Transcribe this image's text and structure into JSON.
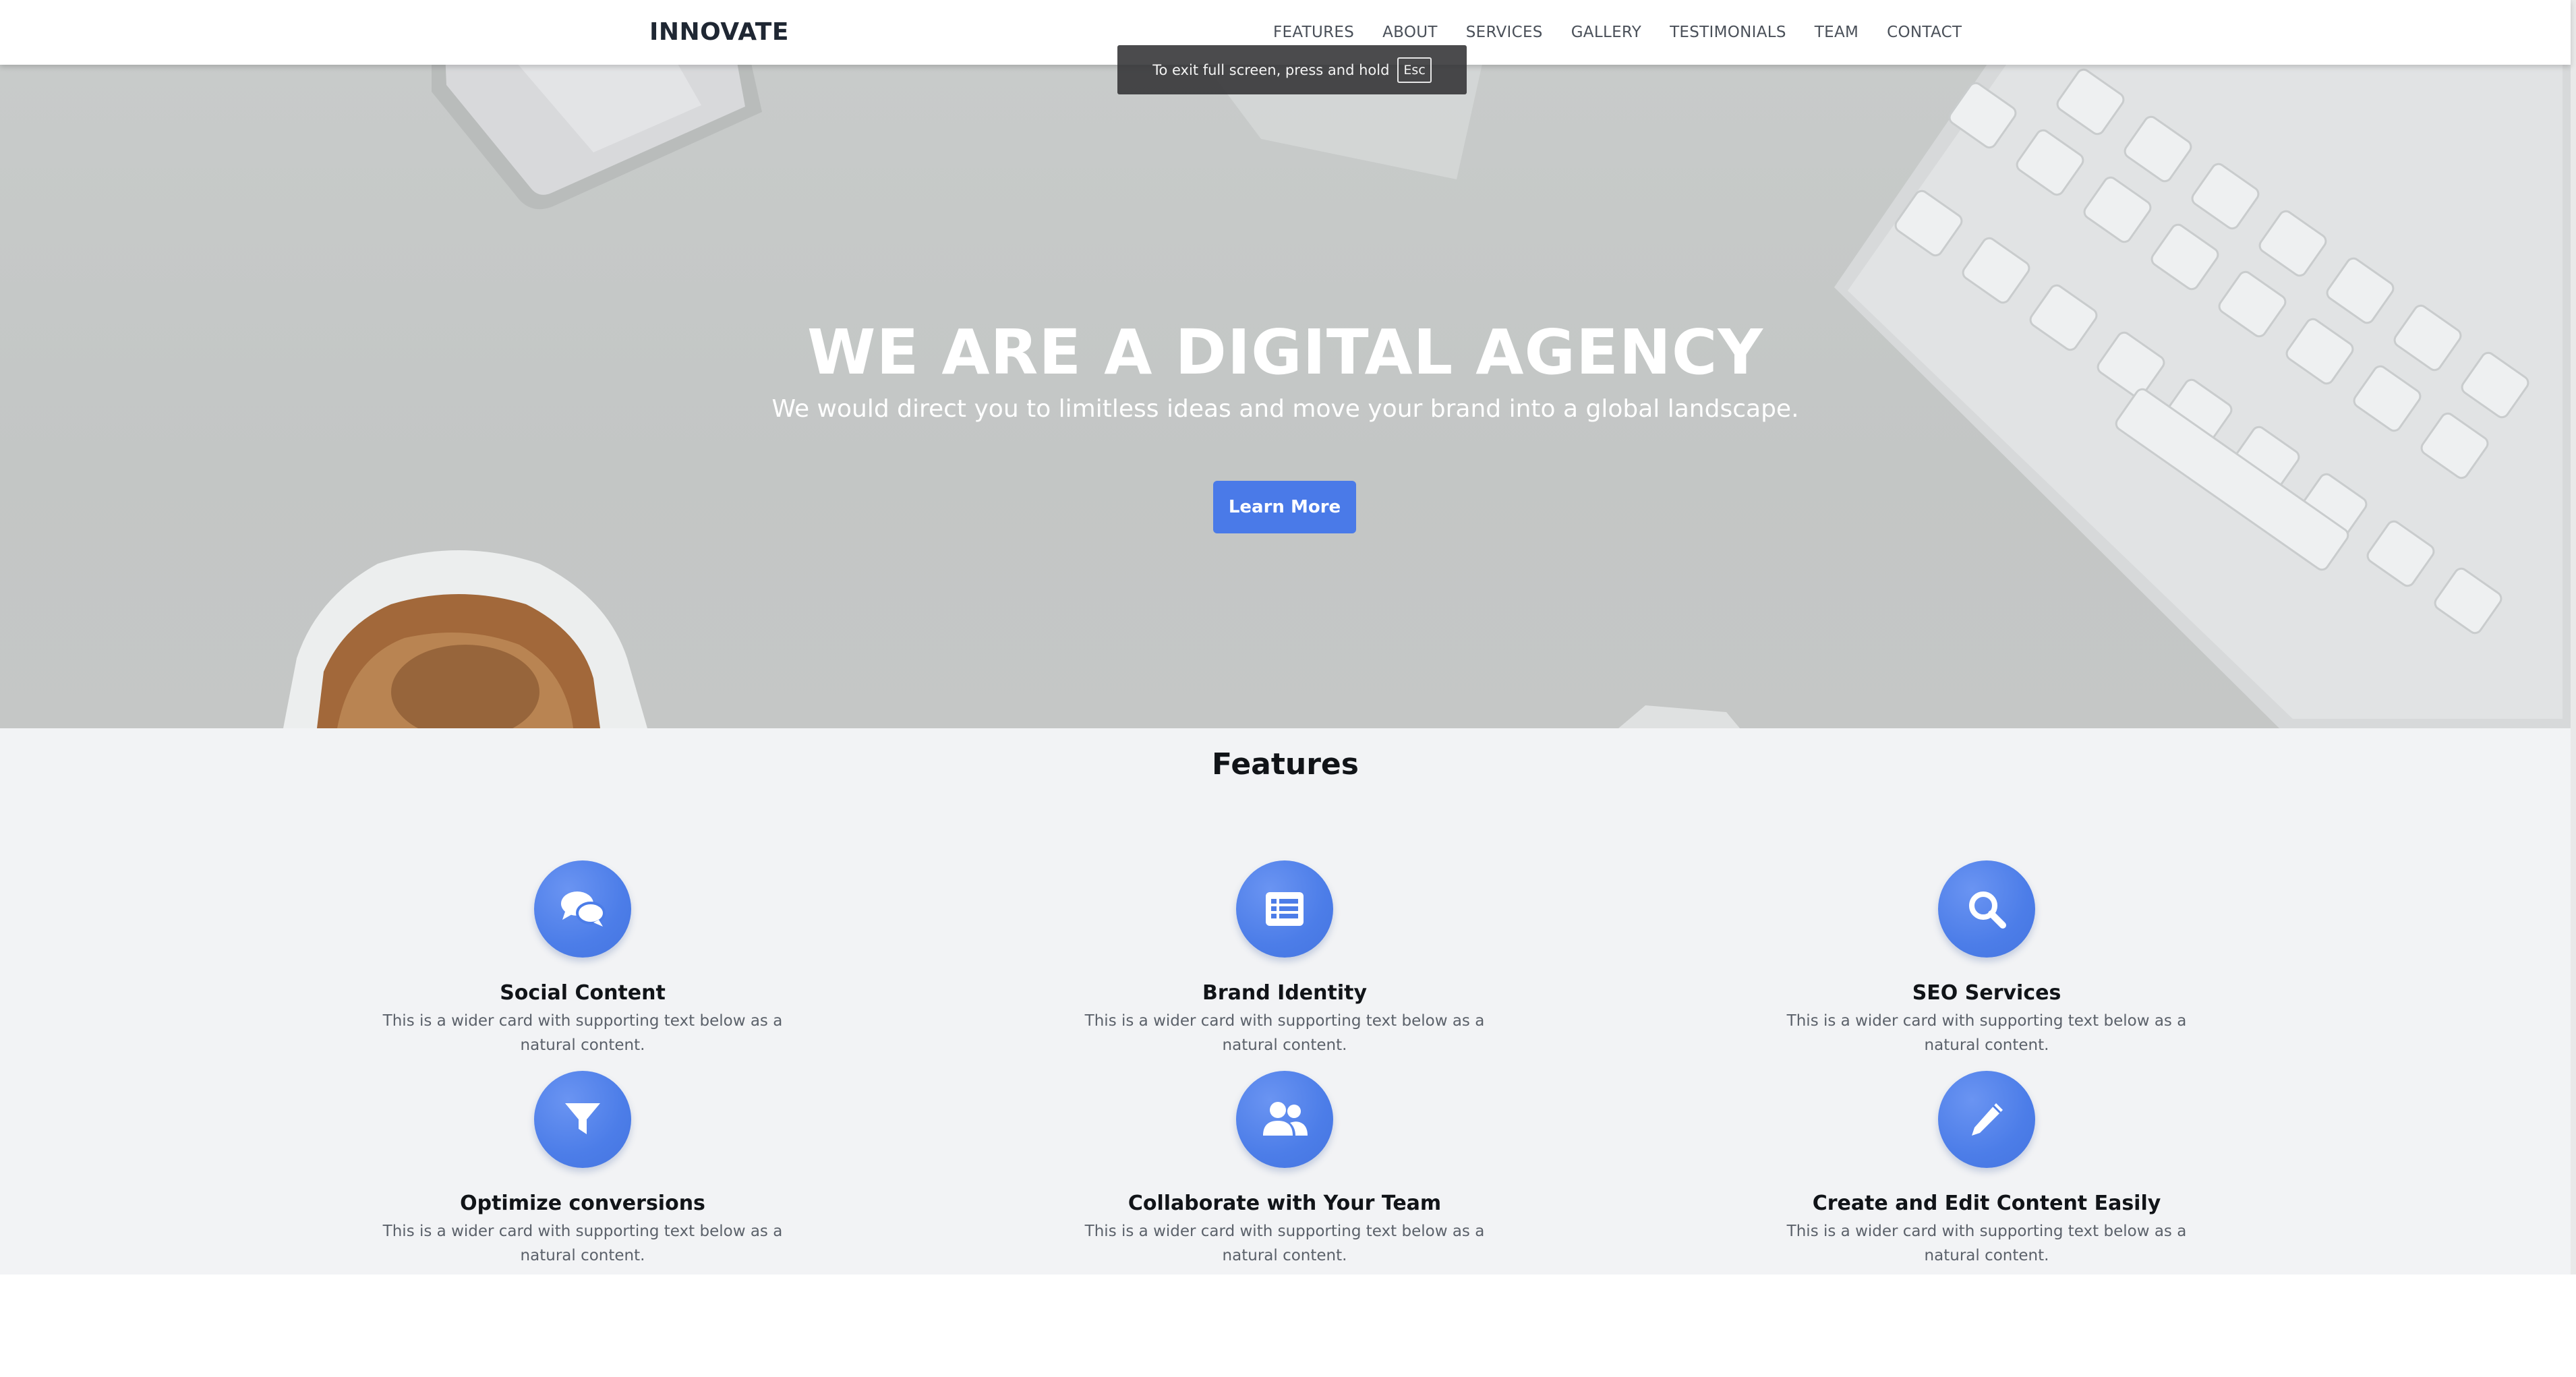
{
  "navbar": {
    "brand": "INNOVATE",
    "links": [
      "FEATURES",
      "ABOUT",
      "SERVICES",
      "GALLERY",
      "TESTIMONIALS",
      "TEAM",
      "CONTACT"
    ]
  },
  "fullscreen_toast": {
    "text": "To exit full screen, press and hold",
    "key": "Esc"
  },
  "hero": {
    "title": "WE ARE A DIGITAL AGENCY",
    "subtitle": "We would direct you to limitless ideas and move your brand into a global landscape.",
    "button_label": "Learn More"
  },
  "features": {
    "title": "Features",
    "items": [
      {
        "title": "Social Content",
        "text": "This is a wider card with supporting text below as a natural content.",
        "icon": "comments-icon"
      },
      {
        "title": "Brand Identity",
        "text": "This is a wider card with supporting text below as a natural content.",
        "icon": "list-icon"
      },
      {
        "title": "SEO Services",
        "text": "This is a wider card with supporting text below as a natural content.",
        "icon": "search-icon"
      },
      {
        "title": "Optimize conversions",
        "text": "This is a wider card with supporting text below as a natural content.",
        "icon": "filter-icon"
      },
      {
        "title": "Collaborate with Your Team",
        "text": "This is a wider card with supporting text below as a natural content.",
        "icon": "users-icon"
      },
      {
        "title": "Create and Edit Content Easily",
        "text": "This is a wider card with supporting text below as a natural content.",
        "icon": "pen-icon"
      }
    ]
  },
  "colors": {
    "accent": "#4a7ae8",
    "hero_bg": "#c5c7c6",
    "features_bg": "#f2f3f5"
  }
}
